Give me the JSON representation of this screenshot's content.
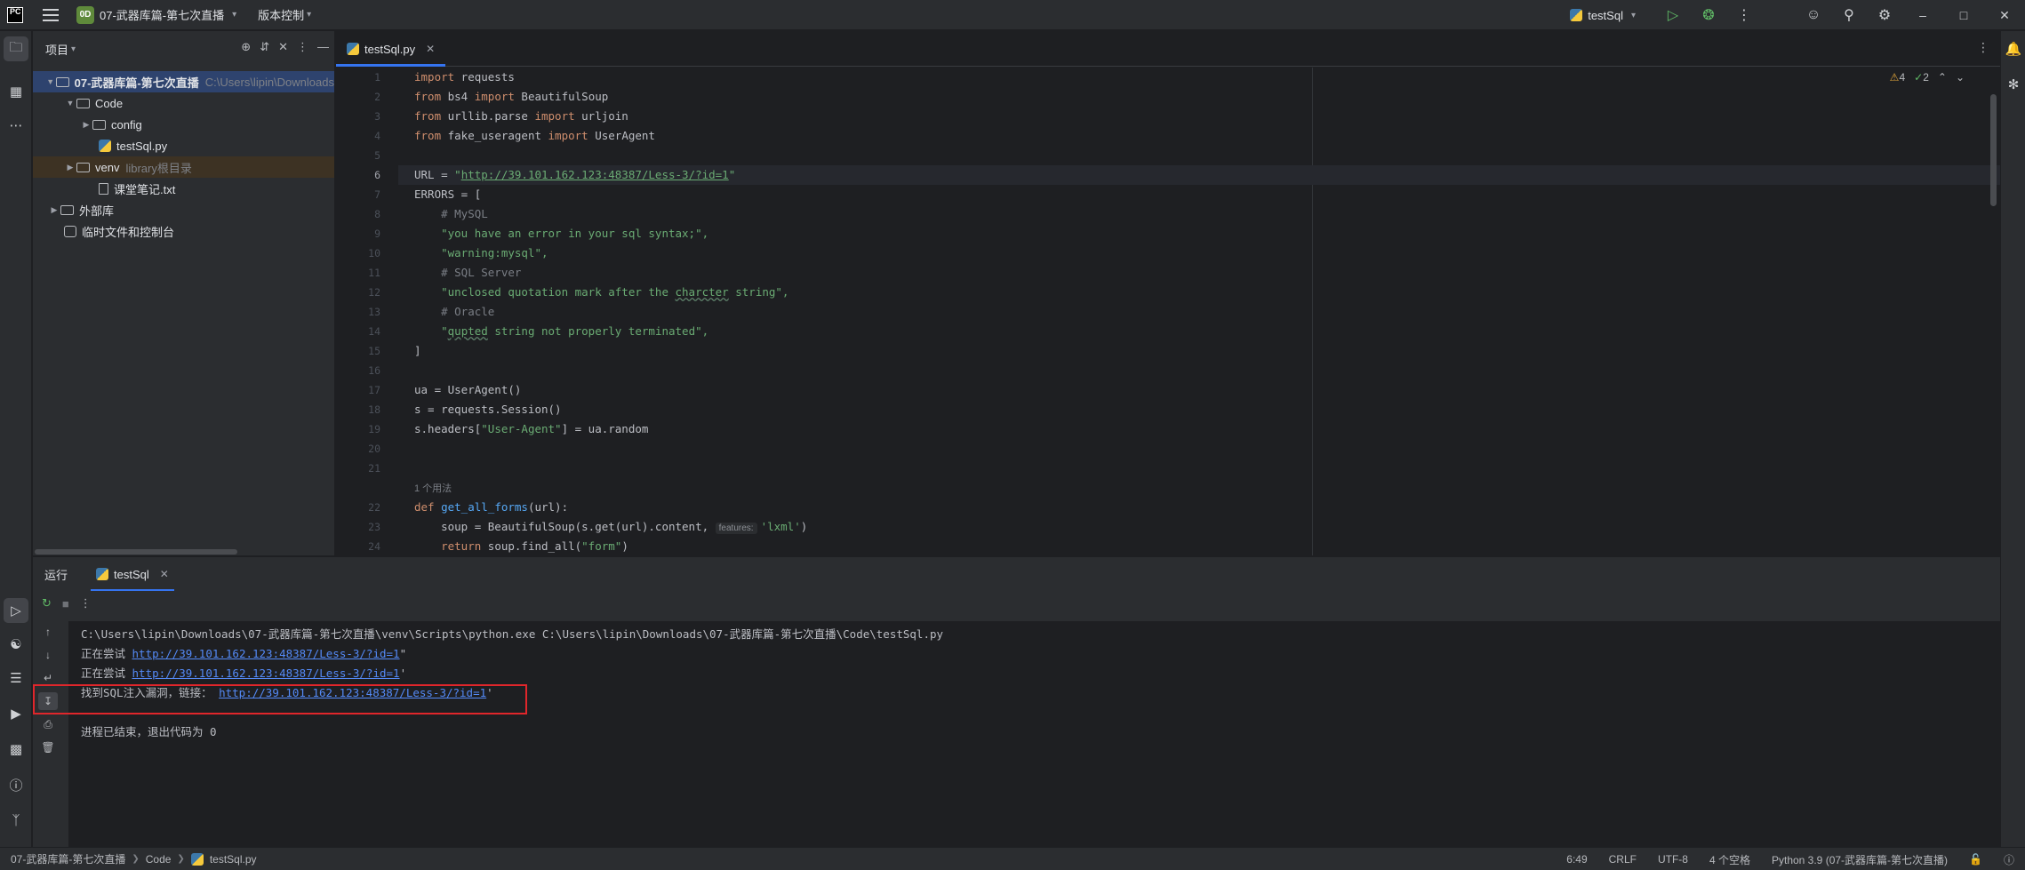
{
  "titlebar": {
    "logo": "PC",
    "project_badge": "0D",
    "project_name": "07-武器库篇-第七次直播",
    "vcs_label": "版本控制",
    "run_config": "testSql"
  },
  "project_panel": {
    "title": "项目",
    "root_name": "07-武器库篇-第七次直播",
    "root_path": "C:\\Users\\lipin\\Downloads",
    "items": [
      {
        "label": "Code"
      },
      {
        "label": "config"
      },
      {
        "label": "testSql.py"
      },
      {
        "label": "venv",
        "hint": "library根目录"
      },
      {
        "label": "课堂笔记.txt"
      },
      {
        "label": "外部库"
      },
      {
        "label": "临时文件和控制台"
      }
    ]
  },
  "editor": {
    "tab_label": "testSql.py",
    "inspections": {
      "warnings": "4",
      "ok": "2"
    },
    "line_numbers": [
      "1",
      "2",
      "3",
      "4",
      "5",
      "6",
      "7",
      "8",
      "9",
      "10",
      "11",
      "12",
      "13",
      "14",
      "15",
      "16",
      "17",
      "18",
      "19",
      "20",
      "21",
      "22",
      "23",
      "24"
    ],
    "code": {
      "l1_kw": "import",
      "l1_rest": " requests",
      "l2_kw1": "from",
      "l2_mid": " bs4 ",
      "l2_kw2": "import",
      "l2_rest": " BeautifulSoup",
      "l3_kw1": "from",
      "l3_mid": " urllib.parse ",
      "l3_kw2": "import",
      "l3_rest": " urljoin",
      "l4_kw1": "from",
      "l4_mid": " fake_useragent ",
      "l4_kw2": "import",
      "l4_rest": " UserAgent",
      "l6_a": "URL = ",
      "l6_q1": "\"",
      "l6_url": "http://39.101.162.123:48387/Less-3/?id=1",
      "l6_q2": "\"",
      "l7": "ERRORS = [",
      "l8": "    # MySQL",
      "l9": "    \"you have an error in your sql syntax;\",",
      "l10": "    \"warning:mysql\",",
      "l11": "    # SQL Server",
      "l12_a": "    \"unclosed quotation mark after the ",
      "l12_b": "charcter",
      "l12_c": " string\",",
      "l13": "    # Oracle",
      "l14_a": "    \"",
      "l14_b": "qupted",
      "l14_c": " string not properly terminated\",",
      "l15": "]",
      "l17": "ua = UserAgent()",
      "l18": "s = requests.Session()",
      "l19_a": "s.headers[",
      "l19_b": "\"User-Agent\"",
      "l19_c": "] = ua.random",
      "usages": "1 个用法",
      "l22_kw": "def",
      "l22_fn": "get_all_forms",
      "l22_rest": "(url):",
      "l23_a": "    soup = BeautifulSoup(s.get(url).content, ",
      "l23_hint": "features:",
      "l23_str": "'lxml'",
      "l23_c": ")",
      "l24_a": "    ",
      "l24_kw": "return",
      "l24_b": " soup.find_all(",
      "l24_str": "\"form\"",
      "l24_c": ")"
    }
  },
  "run_panel": {
    "title": "运行",
    "tab_label": "testSql",
    "console": {
      "cmd": "C:\\Users\\lipin\\Downloads\\07-武器库篇-第七次直播\\venv\\Scripts\\python.exe C:\\Users\\lipin\\Downloads\\07-武器库篇-第七次直播\\Code\\testSql.py",
      "line2_prefix": "正在尝试 ",
      "line2_url": "http://39.101.162.123:48387/Less-3/?id=1",
      "line2_suffix": "\"",
      "line3_prefix": "正在尝试 ",
      "line3_url": "http://39.101.162.123:48387/Less-3/?id=1",
      "line3_suffix": "'",
      "line4_prefix": "找到SQL注入漏洞，链接： ",
      "line4_url": "http://39.101.162.123:48387/Less-3/?id=1",
      "line4_suffix": "'",
      "exit": "进程已结束，退出代码为 0"
    }
  },
  "statusbar": {
    "crumb_project": "07-武器库篇-第七次直播",
    "crumb_folder": "Code",
    "crumb_file": "testSql.py",
    "position": "6:49",
    "line_sep": "CRLF",
    "encoding": "UTF-8",
    "indent": "4 个空格",
    "interpreter": "Python 3.9 (07-武器库篇-第七次直播)"
  },
  "colors": {
    "accent": "#3574f0",
    "highlight_box": "#e0262b",
    "string": "#6aab73",
    "keyword": "#cf8e6d",
    "link": "#548af7"
  }
}
